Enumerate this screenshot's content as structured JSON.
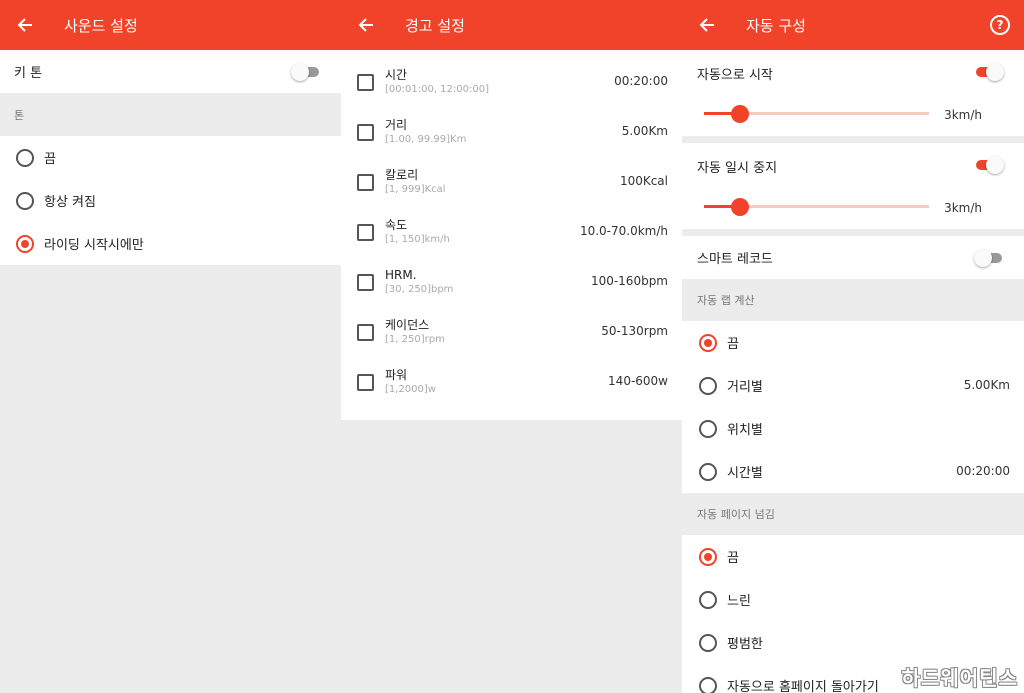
{
  "colors": {
    "accent": "#f0432a"
  },
  "sound": {
    "title": "사운드 설정",
    "key_tone_label": "키 톤",
    "key_tone_on": false,
    "section_label": "톤",
    "options": [
      {
        "label": "끔",
        "selected": false
      },
      {
        "label": "항상 켜짐",
        "selected": false
      },
      {
        "label": "라이딩 시작시에만",
        "selected": true
      }
    ]
  },
  "alerts": {
    "title": "경고 설정",
    "items": [
      {
        "name": "시간",
        "range": "[00:01:00, 12:00:00]",
        "value": "00:20:00",
        "checked": false
      },
      {
        "name": "거리",
        "range": "[1.00, 99.99]Km",
        "value": "5.00Km",
        "checked": false
      },
      {
        "name": "칼로리",
        "range": "[1, 999]Kcal",
        "value": "100Kcal",
        "checked": false
      },
      {
        "name": "속도",
        "range": "[1, 150]km/h",
        "value": "10.0-70.0km/h",
        "checked": false
      },
      {
        "name": "HRM.",
        "range": "[30, 250]bpm",
        "value": "100-160bpm",
        "checked": false
      },
      {
        "name": "케이던스",
        "range": "[1, 250]rpm",
        "value": "50-130rpm",
        "checked": false
      },
      {
        "name": "파워",
        "range": "[1,2000]w",
        "value": "140-600w",
        "checked": false
      }
    ]
  },
  "auto": {
    "title": "자동 구성",
    "help_icon": "?",
    "auto_start": {
      "label": "자동으로 시작",
      "on": true,
      "slider_value": "3km/h",
      "slider_level": 0.16
    },
    "auto_pause": {
      "label": "자동 일시 중지",
      "on": true,
      "slider_value": "3km/h",
      "slider_level": 0.16
    },
    "smart_record": {
      "label": "스마트 레코드",
      "on": false
    },
    "lap_section": "자동 랩 계산",
    "lap_options": [
      {
        "label": "끔",
        "value": "",
        "selected": true
      },
      {
        "label": "거리별",
        "value": "5.00Km",
        "selected": false
      },
      {
        "label": "위치별",
        "value": "",
        "selected": false
      },
      {
        "label": "시간별",
        "value": "00:20:00",
        "selected": false
      }
    ],
    "page_section": "자동 페이지 넘김",
    "page_options": [
      {
        "label": "끔",
        "selected": true
      },
      {
        "label": "느린",
        "selected": false
      },
      {
        "label": "평범한",
        "selected": false
      },
      {
        "label": "자동으로 홈페이지 돌아가기",
        "selected": false
      }
    ]
  },
  "watermark": "하드웨어틴스"
}
